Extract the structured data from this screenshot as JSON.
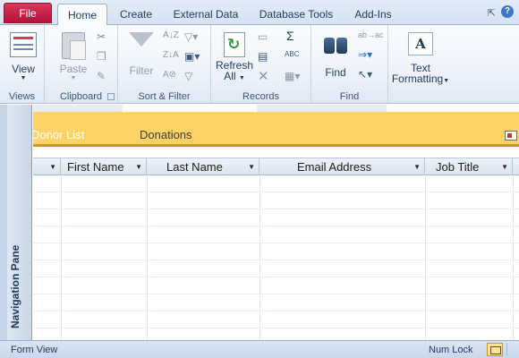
{
  "tabs": [
    "File",
    "Home",
    "Create",
    "External Data",
    "Database Tools",
    "Add-Ins"
  ],
  "active_tab": "Home",
  "ribbon": {
    "views": {
      "view_label": "View",
      "group": "Views"
    },
    "clipboard": {
      "paste_label": "Paste",
      "group": "Clipboard"
    },
    "sort_filter": {
      "filter_label": "Filter",
      "group": "Sort & Filter"
    },
    "records": {
      "refresh_label": "Refresh\nAll",
      "refresh_line1": "Refresh",
      "refresh_line2": "All",
      "totals_glyph": "Σ",
      "delete_glyph": "✕",
      "spelling_glyph": "ABC",
      "group": "Records"
    },
    "find": {
      "find_label": "Find",
      "replace_glyph": "ab→ac",
      "goto_glyph": "⇒",
      "select_glyph": "↖",
      "group": "Find"
    },
    "text_formatting": {
      "line1": "Text",
      "line2": "Formatting",
      "icon_letter": "A"
    }
  },
  "navigation_pane": {
    "label": "Navigation Pane"
  },
  "document": {
    "tabs": [
      "Donor List",
      "Donations"
    ],
    "columns": [
      "First Name",
      "Last Name",
      "Email Address",
      "Job Title"
    ]
  },
  "status_bar": {
    "left": "Form View",
    "right": "Num Lock"
  },
  "colors": {
    "file_tab": "#c11e44",
    "header_band": "#fdd367",
    "ribbon": "#eef3fa"
  },
  "icons": [
    "pin-icon",
    "help-icon",
    "view-icon",
    "paste-icon",
    "cut-icon",
    "copy-icon",
    "format-painter-icon",
    "filter-icon",
    "sort-ascending-icon",
    "sort-descending-icon",
    "refresh-icon",
    "new-record-icon",
    "save-record-icon",
    "delete-icon",
    "totals-icon",
    "spelling-icon",
    "more-icon",
    "find-icon",
    "replace-icon",
    "goto-icon",
    "select-icon",
    "text-formatting-icon",
    "form-view-icon"
  ]
}
